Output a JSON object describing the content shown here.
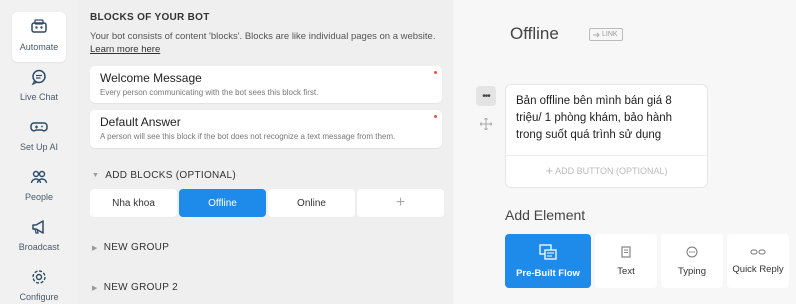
{
  "nav": [
    {
      "label": "Automate",
      "icon": "robot-icon",
      "active": true
    },
    {
      "label": "Live Chat",
      "icon": "chat-bubble-icon",
      "active": false
    },
    {
      "label": "Set Up AI",
      "icon": "gamepad-icon",
      "active": false
    },
    {
      "label": "People",
      "icon": "people-icon",
      "active": false
    },
    {
      "label": "Broadcast",
      "icon": "megaphone-icon",
      "active": false
    },
    {
      "label": "Configure",
      "icon": "gear-icon",
      "active": false
    }
  ],
  "blocks_section": {
    "title": "BLOCKS OF YOUR BOT",
    "description": "Your bot consists of content 'blocks'. Blocks are like individual pages on a website.",
    "learn_more": "Learn more here"
  },
  "default_blocks": [
    {
      "title": "Welcome Message",
      "subtitle": "Every person communicating with the bot sees this block first."
    },
    {
      "title": "Default Answer",
      "subtitle": "A person will see this block if the bot does not recognize a text message from them."
    }
  ],
  "add_blocks": {
    "title": "ADD BLOCKS (OPTIONAL)",
    "chips": [
      "Nha khoa",
      "Offline",
      "Online"
    ],
    "active_chip": "Offline",
    "plus": "+"
  },
  "groups": [
    "NEW GROUP",
    "NEW GROUP 2"
  ],
  "editor": {
    "block_name": "Offline",
    "link_label": "LINK",
    "text_card": "Bản offline bên mình bán giá 8 triệu/ 1 phòng khám, bảo hành trong suốt quá trình sử dụng",
    "add_button": "ADD BUTTON (OPTIONAL)",
    "add_element_title": "Add Element",
    "elements": [
      {
        "label": "Pre-Built Flow",
        "icon": "flow-icon"
      },
      {
        "label": "Text",
        "icon": "text-icon"
      },
      {
        "label": "Typing",
        "icon": "typing-icon"
      },
      {
        "label": "Quick Reply",
        "icon": "quick-reply-icon"
      }
    ]
  },
  "colors": {
    "accent": "#1e8bea",
    "background": "#efefef",
    "card": "#ffffff",
    "dot": "#e05a4a"
  }
}
